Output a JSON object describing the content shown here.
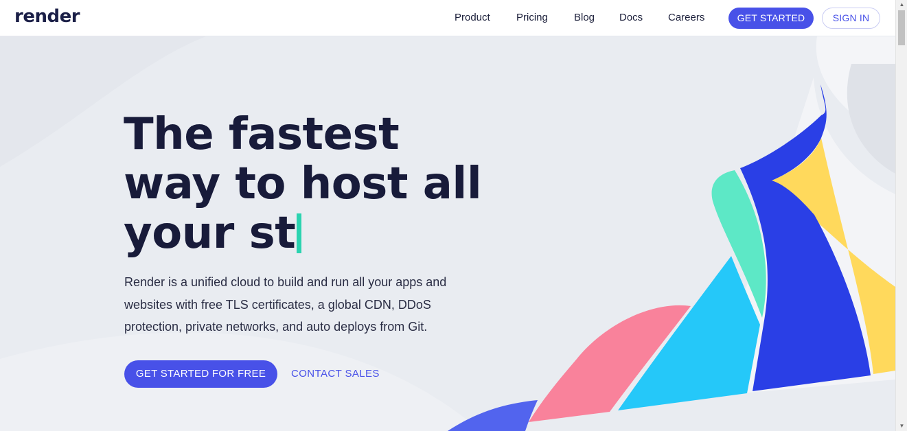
{
  "header": {
    "logo": "render",
    "nav": [
      {
        "label": "Product"
      },
      {
        "label": "Pricing"
      },
      {
        "label": "Blog"
      },
      {
        "label": "Docs"
      },
      {
        "label": "Careers"
      }
    ],
    "get_started": "GET STARTED",
    "sign_in": "SIGN IN"
  },
  "hero": {
    "headline_lines": [
      "The fastest",
      "way to host all",
      "your st"
    ],
    "description": "Render is a unified cloud to build and run all your apps and websites with free TLS certificates, a global CDN, DDoS protection, private networks, and auto deploys from Git.",
    "cta_primary": "GET STARTED FOR FREE",
    "cta_secondary": "CONTACT SALES"
  },
  "colors": {
    "accent": "#4851e8",
    "cursor": "#2bd3b0",
    "shape_blue": "#2a3fe6",
    "shape_yellow": "#ffd95c",
    "shape_teal": "#5de8c6",
    "shape_cyan": "#25c8f9",
    "shape_pink": "#f9829b",
    "shape_indigo": "#5264ee"
  },
  "scrollbar": {
    "up_icon": "▲",
    "down_icon": "▼"
  }
}
